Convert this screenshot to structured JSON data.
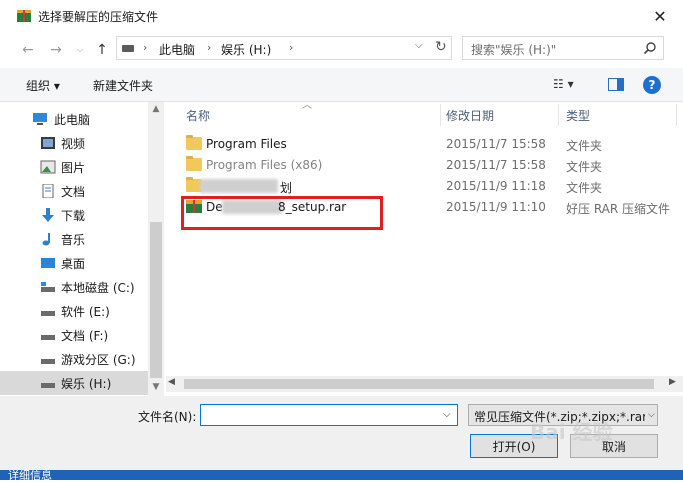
{
  "window": {
    "title": "选择要解压的压缩文件",
    "close_glyph": "✕"
  },
  "address": {
    "back_glyph": "←",
    "forward_glyph": "→",
    "up_glyph": "↑",
    "breadcrumbs": [
      "此电脑",
      "娱乐 (H:)"
    ],
    "separator": "›",
    "dropdown_glyph": "⌵",
    "refresh_glyph": "↻"
  },
  "search": {
    "placeholder": "搜索\"娱乐 (H:)\"",
    "icon": "search-icon"
  },
  "toolbar": {
    "organize": "组织 ▾",
    "new_folder": "新建文件夹",
    "view_menu": "☷ ▾",
    "help": "?"
  },
  "nav": {
    "items": [
      {
        "label": "此电脑",
        "icon": "computer-icon"
      },
      {
        "label": "视频",
        "icon": "video-icon"
      },
      {
        "label": "图片",
        "icon": "pictures-icon"
      },
      {
        "label": "文档",
        "icon": "documents-icon"
      },
      {
        "label": "下载",
        "icon": "download-icon"
      },
      {
        "label": "音乐",
        "icon": "music-icon"
      },
      {
        "label": "桌面",
        "icon": "desktop-icon"
      },
      {
        "label": "本地磁盘 (C:)",
        "icon": "drive-icon"
      },
      {
        "label": "软件 (E:)",
        "icon": "drive-icon"
      },
      {
        "label": "文档 (F:)",
        "icon": "drive-icon"
      },
      {
        "label": "游戏分区 (G:)",
        "icon": "drive-icon"
      },
      {
        "label": "娱乐 (H:)",
        "icon": "drive-icon",
        "selected": true
      }
    ],
    "scroll_up": "▲",
    "scroll_down": "▼"
  },
  "list": {
    "columns": [
      "名称",
      "修改日期",
      "类型"
    ],
    "sort_indicator": "︿",
    "rows": [
      {
        "name": "Program Files",
        "date": "2015/11/7 15:58",
        "type": "文件夹",
        "icon": "folder-icon"
      },
      {
        "name": "Program Files (x86)",
        "date": "2015/11/7 15:58",
        "type": "文件夹",
        "icon": "folder-icon",
        "faded": true
      },
      {
        "name": "划",
        "date": "2015/11/9 11:18",
        "type": "文件夹",
        "icon": "folder-icon",
        "obscured": true
      },
      {
        "name": "De8_setup.rar",
        "name_prefix": "De",
        "name_suffix": "8_setup.rar",
        "date": "2015/11/9 11:10",
        "type": "好压 RAR 压缩文件",
        "icon": "rar-archive-icon",
        "obscured": true
      }
    ],
    "h_scroll_left": "◀",
    "h_scroll_right": "▶"
  },
  "bottom": {
    "filename_label": "文件名(N):",
    "filename_value": "",
    "filename_dropdown": "⌵",
    "filetype_value": "常见压缩文件(*.zip;*.zipx;*.rar",
    "filetype_arrow": "⌵",
    "open_label": "打开(O)",
    "cancel_label": "取消",
    "details_label": "详细信息"
  },
  "watermark": "Bai 经验",
  "colors": {
    "accent": "#0078d7",
    "highlight_box": "#e02020",
    "folder": "#f1c85a",
    "selected_bg": "#d9d9d9"
  }
}
